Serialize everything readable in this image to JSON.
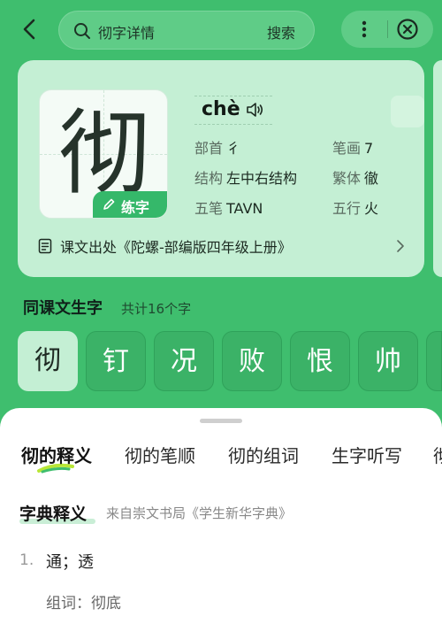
{
  "search": {
    "query": "彻字详情",
    "button_label": "搜索"
  },
  "card": {
    "character": "彻",
    "practice_label": "练字",
    "pinyin": "chè",
    "attributes": {
      "radical": {
        "label": "部首",
        "value": "彳"
      },
      "strokes": {
        "label": "笔画",
        "value": "7"
      },
      "structure": {
        "label": "结构",
        "value": "左中右结构"
      },
      "traditional": {
        "label": "繁体",
        "value": "徹"
      },
      "wubi": {
        "label": "五笔",
        "value": "TAVN"
      },
      "five_elements": {
        "label": "五行",
        "value": "火"
      }
    },
    "source": "课文出处《陀螺-部编版四年级上册》"
  },
  "lesson": {
    "title": "同课文生字",
    "count": "共计16个字",
    "chars": [
      "彻",
      "钉",
      "况",
      "败",
      "恨",
      "帅"
    ]
  },
  "sheet": {
    "tabs": [
      "彻的释义",
      "彻的笔顺",
      "彻的组词",
      "生字听写",
      "彻"
    ],
    "dict_title": "字典释义",
    "dict_source": "来自崇文书局《学生新华字典》",
    "definitions": [
      {
        "num": "1.",
        "text": "通；透",
        "words": "组词：彻底"
      }
    ]
  },
  "colors": {
    "background": "#3fbe6e",
    "card": "#c4efd4",
    "accent": "#35b86a"
  }
}
